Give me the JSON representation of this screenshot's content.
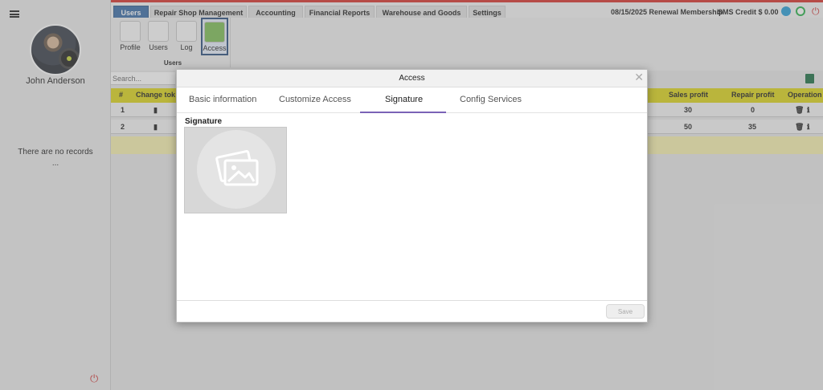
{
  "sidebar": {
    "user_name": "John Anderson",
    "empty_text": "There are no records",
    "empty_dots": "..."
  },
  "topnav": {
    "tabs": [
      {
        "label": "Users",
        "active": true
      },
      {
        "label": "Repair Shop Management"
      },
      {
        "label": "Accounting"
      },
      {
        "label": "Financial Reports"
      },
      {
        "label": "Warehouse and Goods"
      },
      {
        "label": "Settings"
      }
    ],
    "renewal": "08/15/2025 Renewal Membership",
    "sms_credit": "SMS Credit $ 0.00",
    "icons": [
      "telegram-icon",
      "whatsapp-icon",
      "power-icon"
    ]
  },
  "toolbar": {
    "items": [
      {
        "label": "Profile",
        "icon": "profile-icon"
      },
      {
        "label": "Users",
        "icon": "users-icon"
      },
      {
        "label": "Log",
        "icon": "search-icon"
      },
      {
        "label": "Access",
        "icon": "lock-icon",
        "active": true
      }
    ],
    "group_label": "Users"
  },
  "table": {
    "search_placeholder": "Search...",
    "columns": [
      "#",
      "Change tok",
      "Sales profit",
      "Repair profit",
      "Operation"
    ],
    "rows": [
      {
        "num": "1",
        "sales_profit": "30",
        "repair_profit": "0"
      },
      {
        "num": "2",
        "sales_profit": "50",
        "repair_profit": "35"
      }
    ],
    "header_color": "#ddd61c"
  },
  "modal": {
    "title": "Access",
    "tabs": [
      "Basic information",
      "Customize Access",
      "Signature",
      "Config Services"
    ],
    "active_tab": "Signature",
    "section_label": "Signature",
    "save_label": "Save",
    "accent_color": "#7a62b6"
  }
}
